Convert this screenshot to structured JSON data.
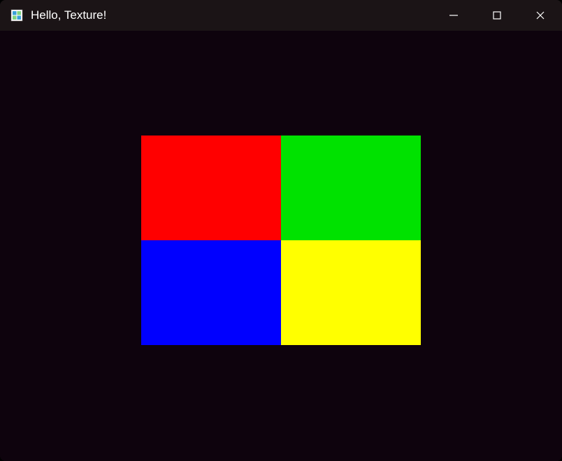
{
  "window": {
    "title": "Hello, Texture!",
    "icon": "texture-app-icon"
  },
  "controls": {
    "minimize": "minimize-button",
    "maximize": "maximize-button",
    "close": "close-button"
  },
  "canvas": {
    "background": "#0e030d",
    "texture": {
      "top_left_color": "#ff0000",
      "top_right_color": "#00e200",
      "bottom_left_color": "#0000ff",
      "bottom_right_color": "#ffff00"
    }
  }
}
